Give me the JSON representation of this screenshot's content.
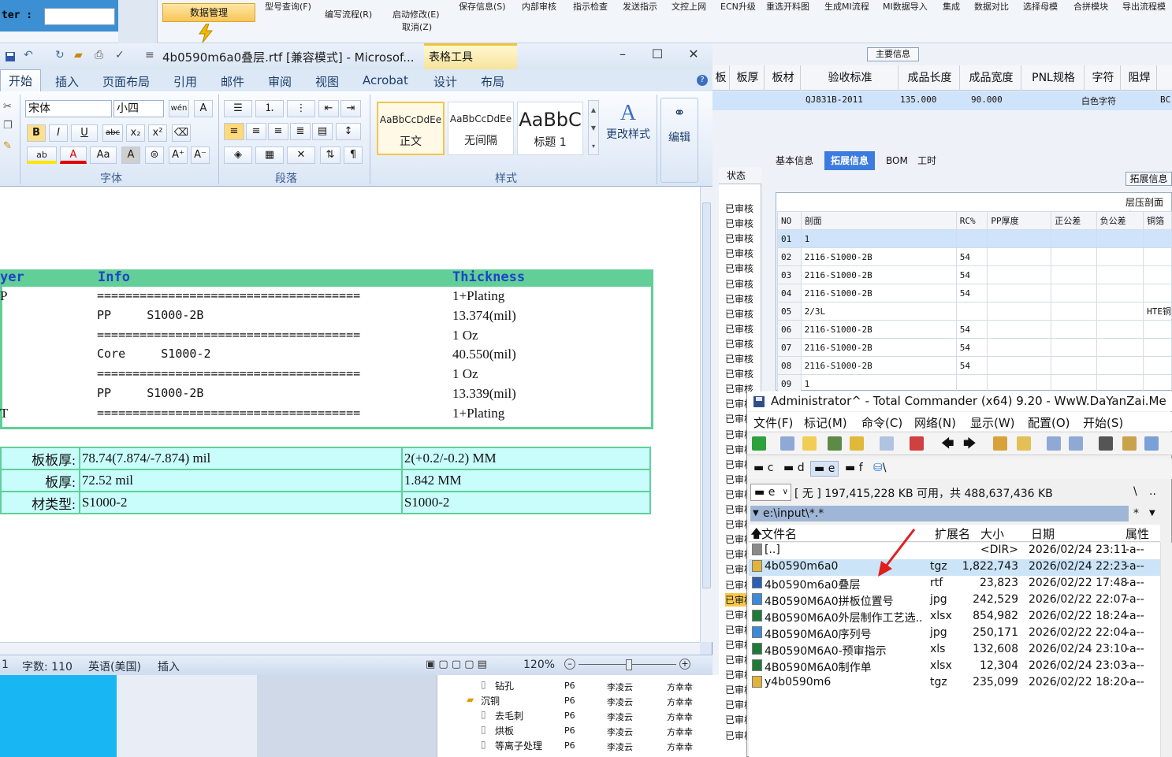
{
  "erp": {
    "filter_label": "ter :",
    "data_mgmt": "数据管理",
    "menu_top": [
      "型号查询(F)",
      "保存信息(S)",
      "内部审核",
      "指示检查",
      "发送指示",
      "文控上网",
      "ECN升级",
      "重选开料图",
      "生成MI流程",
      "MI数据导入",
      "集成",
      "数据对比",
      "选择母模",
      "合拼模块",
      "导出流程模"
    ],
    "menu_sub": [
      "编写流程(R)",
      "启动修改(E)",
      "取消(Z)"
    ],
    "main_info": "主要信息",
    "columns": [
      "板",
      "板厚",
      "板材",
      "验收标准",
      "成品长度",
      "成品宽度",
      "PNL规格",
      "字符",
      "阻焊"
    ],
    "values": [
      "QJ831B-2011",
      "135.000",
      "90.000",
      "白色字符",
      "BC"
    ],
    "status_header": "状态",
    "status_value": "已审核",
    "tabs": [
      "基本信息",
      "拓展信息",
      "BOM",
      "工时"
    ],
    "ext_info_btn": "拓展信息",
    "layer_title": "层压剖面表",
    "layer_headers": [
      "NO",
      "剖面",
      "RC%",
      "PP厚度",
      "正公差",
      "负公差",
      "铜箔"
    ],
    "layer_rows": [
      {
        "no": "01",
        "section": "1",
        "rc": "",
        "extra": ""
      },
      {
        "no": "02",
        "section": "2116-S1000-2B",
        "rc": "54",
        "extra": ""
      },
      {
        "no": "03",
        "section": "2116-S1000-2B",
        "rc": "54",
        "extra": ""
      },
      {
        "no": "04",
        "section": "2116-S1000-2B",
        "rc": "54",
        "extra": ""
      },
      {
        "no": "05",
        "section": "2/3L",
        "rc": "",
        "extra": "HTE铜"
      },
      {
        "no": "06",
        "section": "2116-S1000-2B",
        "rc": "54",
        "extra": ""
      },
      {
        "no": "07",
        "section": "2116-S1000-2B",
        "rc": "54",
        "extra": ""
      },
      {
        "no": "08",
        "section": "2116-S1000-2B",
        "rc": "54",
        "extra": ""
      },
      {
        "no": "09",
        "section": "1",
        "rc": "",
        "extra": ""
      }
    ],
    "tree_rows": [
      {
        "name": "钻孔",
        "code": "P6",
        "person": "李凌云",
        "owner": "方幸幸"
      },
      {
        "name": "沉铜",
        "code": "P6",
        "person": "李凌云",
        "owner": "方幸幸"
      },
      {
        "name": "去毛刺",
        "code": "P6",
        "person": "李凌云",
        "owner": "方幸幸"
      },
      {
        "name": "烘板",
        "code": "P6",
        "person": "李凌云",
        "owner": "方幸幸"
      },
      {
        "name": "等离子处理",
        "code": "P6",
        "person": "李凌云",
        "owner": "方幸幸"
      }
    ]
  },
  "word": {
    "title": "4b0590m6a0叠层.rtf [兼容模式] - Microsof...",
    "table_tools": "表格工具",
    "tabs": [
      "开始",
      "插入",
      "页面布局",
      "引用",
      "邮件",
      "审阅",
      "视图",
      "Acrobat",
      "设计",
      "布局"
    ],
    "font_name": "宋体",
    "font_size": "小四",
    "groups": {
      "font": "字体",
      "paragraph": "段落",
      "styles": "样式"
    },
    "styles": [
      {
        "sample": "AaBbCcDdEe",
        "name": "正文"
      },
      {
        "sample": "AaBbCcDdEe",
        "name": "无间隔"
      },
      {
        "sample": "AaBbC",
        "name": "标题 1"
      }
    ],
    "change_styles": "更改样式",
    "edit": "编辑",
    "doc": {
      "headers": [
        "yer",
        "Info",
        "Thickness"
      ],
      "rows": [
        {
          "a": "P",
          "info": "=====================================",
          "thk": "1+Plating"
        },
        {
          "a": "",
          "info": "PP     S1000-2B",
          "thk": "13.374(mil)"
        },
        {
          "a": "",
          "info": "=====================================",
          "thk": "1 Oz"
        },
        {
          "a": "",
          "info": "Core     S1000-2",
          "thk": "40.550(mil)"
        },
        {
          "a": "",
          "info": "=====================================",
          "thk": "1 Oz"
        },
        {
          "a": "",
          "info": "PP     S1000-2B",
          "thk": "13.339(mil)"
        },
        {
          "a": "T",
          "info": "=====================================",
          "thk": "1+Plating"
        }
      ],
      "summary": [
        [
          "板板厚:",
          "78.74(7.874/-7.874) mil",
          "2(+0.2/-0.2) MM"
        ],
        [
          "板厚:",
          "72.52 mil",
          "1.842 MM"
        ],
        [
          "材类型:",
          "S1000-2",
          "S1000-2"
        ]
      ]
    },
    "status": {
      "page": "1",
      "words": "字数: 110",
      "lang": "英语(美国)",
      "mode": "插入",
      "zoom": "120%"
    }
  },
  "tc": {
    "title": "Administrator^ - Total Commander (x64) 9.20 - WwW.DaYanZai.Me",
    "menu": [
      "文件(F)",
      "标记(M)",
      "命令(C)",
      "网络(N)",
      "显示(W)",
      "配置(O)",
      "开始(S)"
    ],
    "drives": [
      "c",
      "d",
      "e",
      "f",
      "\\"
    ],
    "current_drive": "e",
    "free_text": "[ 无 ]  197,415,228 KB 可用，共 488,637,436 KB",
    "path": "e:\\input\\*.*",
    "filter": "*",
    "columns": [
      "文件名",
      "扩展名",
      "大小",
      "日期",
      "属性"
    ],
    "files": [
      {
        "name": "[..]",
        "ext": "",
        "size": "<DIR>",
        "date": "2026/02/24 23:11",
        "attr": "-a--"
      },
      {
        "name": "4b0590m6a0",
        "ext": "tgz",
        "size": "1,822,743",
        "date": "2026/02/24 22:23",
        "attr": "-a--"
      },
      {
        "name": "4b0590m6a0叠层",
        "ext": "rtf",
        "size": "23,823",
        "date": "2026/02/22 17:48",
        "attr": "-a--"
      },
      {
        "name": "4B0590M6A0拼板位置号",
        "ext": "jpg",
        "size": "242,529",
        "date": "2026/02/22 22:07",
        "attr": "-a--"
      },
      {
        "name": "4B0590M6A0外层制作工艺选..",
        "ext": "xlsx",
        "size": "854,982",
        "date": "2026/02/22 18:24",
        "attr": "-a--"
      },
      {
        "name": "4B0590M6A0序列号",
        "ext": "jpg",
        "size": "250,171",
        "date": "2026/02/22 22:04",
        "attr": "-a--"
      },
      {
        "name": "4B0590M6A0-预审指示",
        "ext": "xls",
        "size": "132,608",
        "date": "2026/02/24 23:10",
        "attr": "-a--"
      },
      {
        "name": "4B0590M6A0制作单",
        "ext": "xlsx",
        "size": "12,304",
        "date": "2026/02/24 23:03",
        "attr": "-a--"
      },
      {
        "name": "y4b0590m6",
        "ext": "tgz",
        "size": "235,099",
        "date": "2026/02/22 18:20",
        "attr": "-a--"
      }
    ]
  },
  "colors": {
    "accent": "#3c7be0",
    "doc_table_border": "#5fcf97",
    "doc_table_fill": "#c8fdfb",
    "arrow": "#e01e1e"
  }
}
